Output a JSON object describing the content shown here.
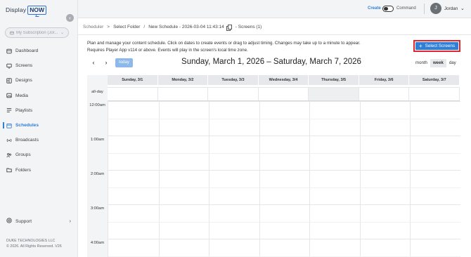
{
  "brand": {
    "part1": "Display",
    "part2": "NOW"
  },
  "sidebar": {
    "subscription_placeholder": "My Subscription (Jor...",
    "items": [
      {
        "label": "Dashboard",
        "icon": "dashboard-icon"
      },
      {
        "label": "Screens",
        "icon": "monitor-icon"
      },
      {
        "label": "Designs",
        "icon": "designs-icon"
      },
      {
        "label": "Media",
        "icon": "media-icon"
      },
      {
        "label": "Playlists",
        "icon": "playlist-icon"
      },
      {
        "label": "Schedules",
        "icon": "calendar-icon",
        "active": true
      },
      {
        "label": "Broadcasts",
        "icon": "broadcast-icon"
      },
      {
        "label": "Groups",
        "icon": "groups-icon"
      },
      {
        "label": "Folders",
        "icon": "folder-icon"
      }
    ],
    "support_label": "Support",
    "footer_company": "DUKE TECHNOLOGIES LLC",
    "footer_copyright": "© 2026. All Rights Reserved. V26"
  },
  "topbar": {
    "create_label": "Create",
    "command_label": "Command",
    "avatar_initial": "J",
    "user_name": "Jordan"
  },
  "breadcrumb": {
    "root": "Scheduler",
    "folder": "Select Folder",
    "schedule": "New Schedule - 2026-03-04 11:43:14",
    "screens": "- Screens (1)"
  },
  "description": {
    "line1": "Plan and manage your content schedule. Click on dates to create events or drag to adjust timing. Changes may take up to a minute to appear.",
    "line2": "Requires Player App v114 or above. Events will play in the screen's local time zone."
  },
  "select_screens_label": "Select Screens",
  "calendar": {
    "prev": "‹",
    "next": "›",
    "today_label": "today",
    "title": "Sunday, March 1, 2026 – Saturday, March 7, 2026",
    "views": [
      "month",
      "week",
      "day"
    ],
    "active_view": "week",
    "days": [
      "Sunday, 3/1",
      "Monday, 3/2",
      "Tuesday, 3/3",
      "Wednesday, 3/4",
      "Thursday, 3/5",
      "Friday, 3/6",
      "Saturday, 3/7"
    ],
    "today_index": 4,
    "allday_label": "all-day",
    "times": [
      "12:00am",
      "1:00am",
      "2:00am",
      "3:00am",
      "4:00am"
    ]
  }
}
